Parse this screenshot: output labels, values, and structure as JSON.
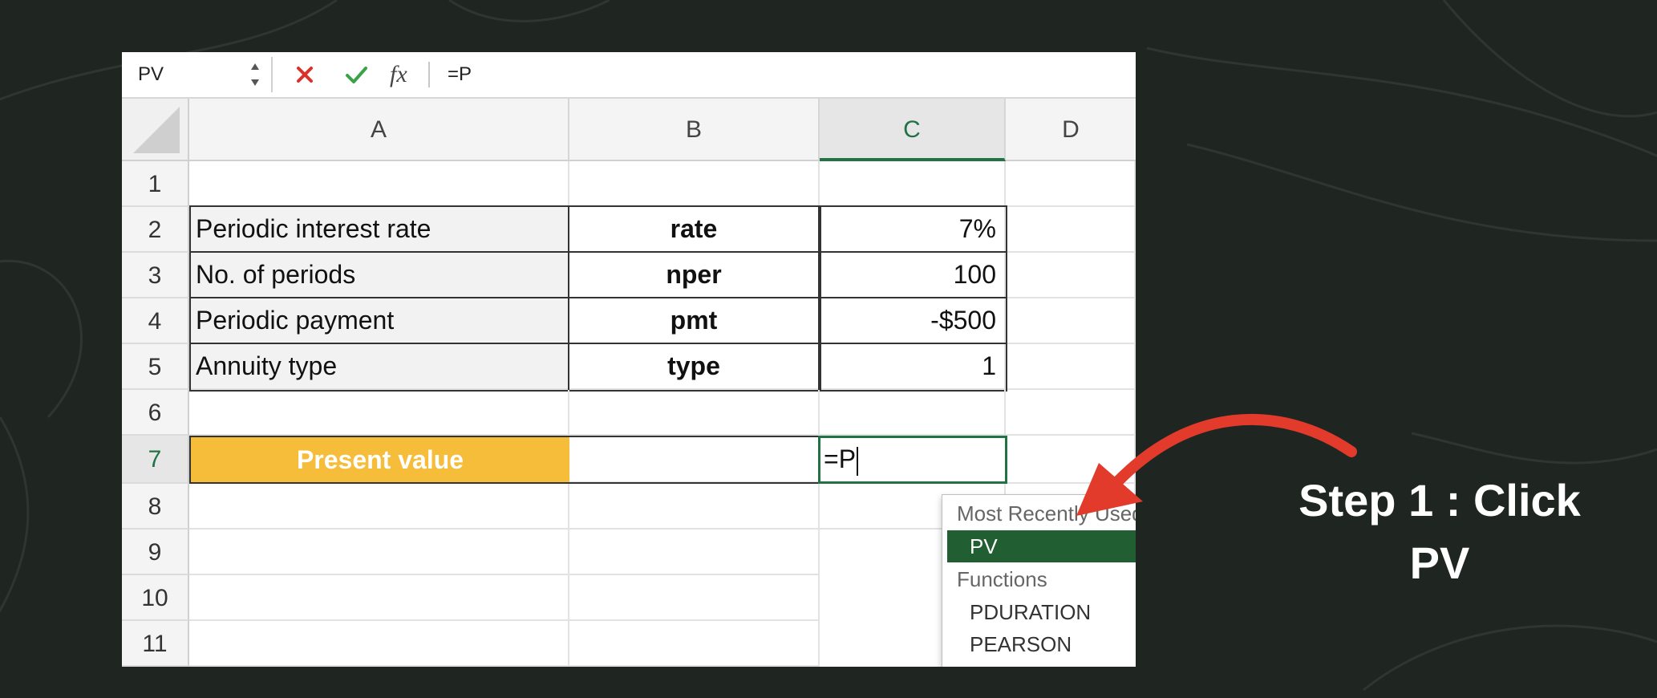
{
  "formula_bar": {
    "name_box": "PV",
    "formula": "=P",
    "fx_label": "fx",
    "cancel_icon": "cross-icon",
    "enter_icon": "check-icon"
  },
  "columns": [
    "A",
    "B",
    "C",
    "D"
  ],
  "active_column": "C",
  "rows": [
    "1",
    "2",
    "3",
    "4",
    "5",
    "6",
    "7",
    "8",
    "9",
    "10",
    "11"
  ],
  "active_row": "7",
  "table": [
    {
      "label": "Periodic interest rate",
      "key": "rate",
      "value": "7%"
    },
    {
      "label": "No. of periods",
      "key": "nper",
      "value": "100"
    },
    {
      "label": "Periodic payment",
      "key": "pmt",
      "value": "-$500"
    },
    {
      "label": "Annuity type",
      "key": "type",
      "value": "1"
    }
  ],
  "present_value": {
    "label": "Present value",
    "input": "=P"
  },
  "autocomplete": {
    "recent_header": "Most Recently Used",
    "recent_items": [
      "PV"
    ],
    "functions_header": "Functions",
    "function_items": [
      "PDURATION",
      "PEARSON"
    ]
  },
  "annotation": {
    "line1": "Step 1 : Click",
    "line2": "PV"
  },
  "colors": {
    "background": "#1f2622",
    "accent_green": "#217346",
    "highlight_yellow": "#f5bd3a",
    "arrow_red": "#e23a2b"
  }
}
